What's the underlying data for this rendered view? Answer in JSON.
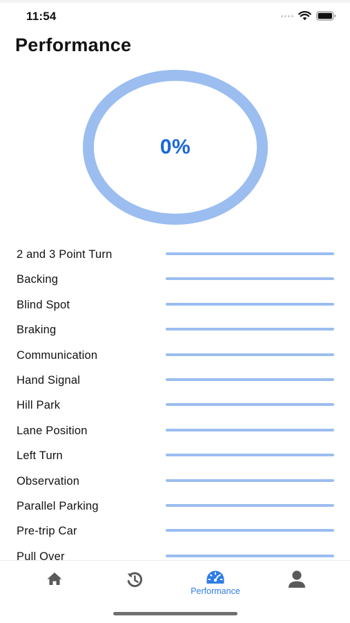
{
  "status_bar": {
    "time": "11:54"
  },
  "page": {
    "title": "Performance"
  },
  "overall": {
    "percent_text": "0%",
    "progress_fraction": 0.0
  },
  "skills": [
    {
      "label": "2 and 3 Point Turn",
      "progress_fraction": 0.0
    },
    {
      "label": "Backing",
      "progress_fraction": 0.0
    },
    {
      "label": "Blind Spot",
      "progress_fraction": 0.0
    },
    {
      "label": "Braking",
      "progress_fraction": 0.0
    },
    {
      "label": "Communication",
      "progress_fraction": 0.0
    },
    {
      "label": "Hand Signal",
      "progress_fraction": 0.0
    },
    {
      "label": "Hill Park",
      "progress_fraction": 0.0
    },
    {
      "label": "Lane Position",
      "progress_fraction": 0.0
    },
    {
      "label": "Left Turn",
      "progress_fraction": 0.0
    },
    {
      "label": "Observation",
      "progress_fraction": 0.0
    },
    {
      "label": "Parallel Parking",
      "progress_fraction": 0.0
    },
    {
      "label": "Pre-trip Car",
      "progress_fraction": 0.0
    },
    {
      "label": "Pull Over",
      "progress_fraction": 0.0
    }
  ],
  "tab_bar": {
    "tabs": [
      {
        "icon": "home-icon",
        "label": "",
        "active": false
      },
      {
        "icon": "history-icon",
        "label": "",
        "active": false
      },
      {
        "icon": "speedometer-icon",
        "label": "Performance",
        "active": true
      },
      {
        "icon": "profile-icon",
        "label": "",
        "active": false
      }
    ]
  },
  "colors": {
    "accent": "#1a66d8",
    "ring_track": "#9bbdf0",
    "tab_inactive": "#5a5a5a",
    "tab_active": "#2f7ce6"
  }
}
